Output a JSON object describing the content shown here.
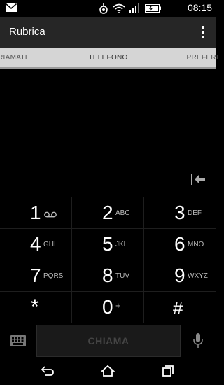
{
  "status_bar": {
    "time": "08:15",
    "icons": [
      "mail-icon",
      "nfc-icon",
      "wifi-icon",
      "signal-icon",
      "battery-icon"
    ]
  },
  "app_bar": {
    "title": "Rubrica",
    "menu_icon": "overflow-menu-icon"
  },
  "tabs": {
    "left": "RIAMATE",
    "center": "TELEFONO",
    "right": "PREFERI"
  },
  "keypad": {
    "keys": [
      {
        "digit": "1",
        "letters": "",
        "voicemail": true
      },
      {
        "digit": "2",
        "letters": "ABC"
      },
      {
        "digit": "3",
        "letters": "DEF"
      },
      {
        "digit": "4",
        "letters": "GHI"
      },
      {
        "digit": "5",
        "letters": "JKL"
      },
      {
        "digit": "6",
        "letters": "MNO"
      },
      {
        "digit": "7",
        "letters": "PQRS"
      },
      {
        "digit": "8",
        "letters": "TUV"
      },
      {
        "digit": "9",
        "letters": "WXYZ"
      },
      {
        "digit": "*",
        "letters": ""
      },
      {
        "digit": "0",
        "letters": "+"
      },
      {
        "digit": "#",
        "letters": ""
      }
    ]
  },
  "actions": {
    "call_label": "CHIAMA"
  },
  "colors": {
    "background": "#000000",
    "app_bar": "#262626",
    "tab_bar": "#d5d5d5"
  }
}
